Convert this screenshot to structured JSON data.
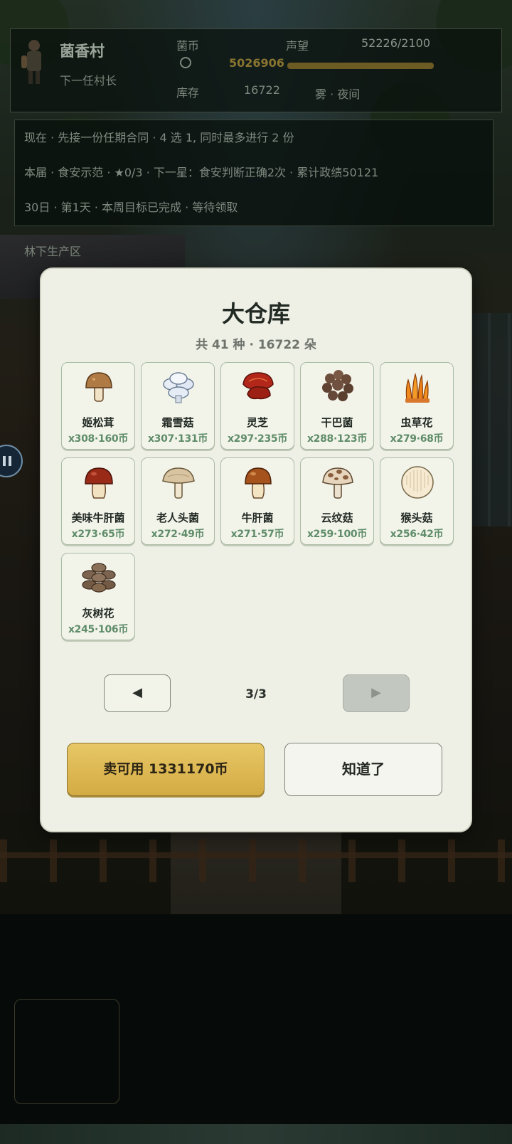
{
  "header": {
    "village_name": "菌香村",
    "role": "下一任村长",
    "coin_label": "菌币",
    "coin_value": "5026906",
    "reputation_label": "声望",
    "reputation_value": "52226/2100",
    "reputation_progress": 1.0,
    "stock_label": "库存",
    "stock_value": "16722",
    "weather": "雾 · 夜间"
  },
  "info": {
    "line1": "现在 · 先接一份任期合同 · 4 选 1, 同时最多进行 2 份",
    "line2": "本届 · 食安示范 · ★0/3 · 下一星：食安判断正确2次 · 累计政绩50121",
    "line3": "30日 · 第1天 · 本周目标已完成 · 等待领取"
  },
  "zone_label": "林下生产区",
  "modal": {
    "title": "大仓库",
    "subtitle": "共 41 种 · 16722 朵",
    "items": [
      {
        "name": "姬松茸",
        "qty": "x308·160币",
        "icon": "brown-cap-mushroom-icon"
      },
      {
        "name": "霜雪菇",
        "qty": "x307·131币",
        "icon": "white-cluster-mushroom-icon"
      },
      {
        "name": "灵芝",
        "qty": "x297·235币",
        "icon": "reishi-icon"
      },
      {
        "name": "干巴菌",
        "qty": "x288·123币",
        "icon": "coral-brown-fungus-icon"
      },
      {
        "name": "虫草花",
        "qty": "x279·68币",
        "icon": "cordyceps-icon"
      },
      {
        "name": "美味牛肝菌",
        "qty": "x273·65币",
        "icon": "red-bolete-icon"
      },
      {
        "name": "老人头菌",
        "qty": "x272·49币",
        "icon": "tan-cap-mushroom-icon"
      },
      {
        "name": "牛肝菌",
        "qty": "x271·57币",
        "icon": "bolete-icon"
      },
      {
        "name": "云纹菇",
        "qty": "x259·100币",
        "icon": "spotted-cap-mushroom-icon"
      },
      {
        "name": "猴头菇",
        "qty": "x256·42币",
        "icon": "lions-mane-icon"
      },
      {
        "name": "灰树花",
        "qty": "x245·106币",
        "icon": "maitake-icon"
      }
    ],
    "prev_label": "◀",
    "next_label": "▶",
    "page_indicator": "3/3",
    "sell_label": "卖可用 1331170币",
    "ok_label": "知道了"
  },
  "colors": {
    "accent_gold": "#d4ab43",
    "quantity_green": "#5f8c69",
    "modal_bg": "#eef0e6"
  }
}
